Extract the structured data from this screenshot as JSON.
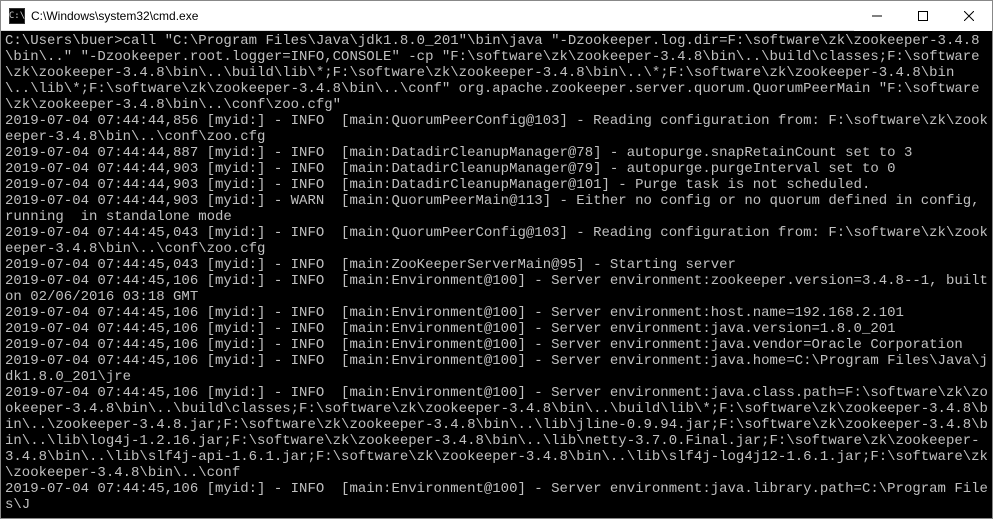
{
  "window": {
    "icon_text": "C:\\",
    "title": "C:\\Windows\\system32\\cmd.exe"
  },
  "lines": [
    "",
    "C:\\Users\\buer>call \"C:\\Program Files\\Java\\jdk1.8.0_201\"\\bin\\java \"-Dzookeeper.log.dir=F:\\software\\zk\\zookeeper-3.4.8\\bin\\..\" \"-Dzookeeper.root.logger=INFO,CONSOLE\" -cp \"F:\\software\\zk\\zookeeper-3.4.8\\bin\\..\\build\\classes;F:\\software\\zk\\zookeeper-3.4.8\\bin\\..\\build\\lib\\*;F:\\software\\zk\\zookeeper-3.4.8\\bin\\..\\*;F:\\software\\zk\\zookeeper-3.4.8\\bin\\..\\lib\\*;F:\\software\\zk\\zookeeper-3.4.8\\bin\\..\\conf\" org.apache.zookeeper.server.quorum.QuorumPeerMain \"F:\\software\\zk\\zookeeper-3.4.8\\bin\\..\\conf\\zoo.cfg\"",
    "2019-07-04 07:44:44,856 [myid:] - INFO  [main:QuorumPeerConfig@103] - Reading configuration from: F:\\software\\zk\\zookeeper-3.4.8\\bin\\..\\conf\\zoo.cfg",
    "2019-07-04 07:44:44,887 [myid:] - INFO  [main:DatadirCleanupManager@78] - autopurge.snapRetainCount set to 3",
    "2019-07-04 07:44:44,903 [myid:] - INFO  [main:DatadirCleanupManager@79] - autopurge.purgeInterval set to 0",
    "2019-07-04 07:44:44,903 [myid:] - INFO  [main:DatadirCleanupManager@101] - Purge task is not scheduled.",
    "2019-07-04 07:44:44,903 [myid:] - WARN  [main:QuorumPeerMain@113] - Either no config or no quorum defined in config, running  in standalone mode",
    "2019-07-04 07:44:45,043 [myid:] - INFO  [main:QuorumPeerConfig@103] - Reading configuration from: F:\\software\\zk\\zookeeper-3.4.8\\bin\\..\\conf\\zoo.cfg",
    "2019-07-04 07:44:45,043 [myid:] - INFO  [main:ZooKeeperServerMain@95] - Starting server",
    "2019-07-04 07:44:45,106 [myid:] - INFO  [main:Environment@100] - Server environment:zookeeper.version=3.4.8--1, built on 02/06/2016 03:18 GMT",
    "2019-07-04 07:44:45,106 [myid:] - INFO  [main:Environment@100] - Server environment:host.name=192.168.2.101",
    "2019-07-04 07:44:45,106 [myid:] - INFO  [main:Environment@100] - Server environment:java.version=1.8.0_201",
    "2019-07-04 07:44:45,106 [myid:] - INFO  [main:Environment@100] - Server environment:java.vendor=Oracle Corporation",
    "2019-07-04 07:44:45,106 [myid:] - INFO  [main:Environment@100] - Server environment:java.home=C:\\Program Files\\Java\\jdk1.8.0_201\\jre",
    "2019-07-04 07:44:45,106 [myid:] - INFO  [main:Environment@100] - Server environment:java.class.path=F:\\software\\zk\\zookeeper-3.4.8\\bin\\..\\build\\classes;F:\\software\\zk\\zookeeper-3.4.8\\bin\\..\\build\\lib\\*;F:\\software\\zk\\zookeeper-3.4.8\\bin\\..\\zookeeper-3.4.8.jar;F:\\software\\zk\\zookeeper-3.4.8\\bin\\..\\lib\\jline-0.9.94.jar;F:\\software\\zk\\zookeeper-3.4.8\\bin\\..\\lib\\log4j-1.2.16.jar;F:\\software\\zk\\zookeeper-3.4.8\\bin\\..\\lib\\netty-3.7.0.Final.jar;F:\\software\\zk\\zookeeper-3.4.8\\bin\\..\\lib\\slf4j-api-1.6.1.jar;F:\\software\\zk\\zookeeper-3.4.8\\bin\\..\\lib\\slf4j-log4j12-1.6.1.jar;F:\\software\\zk\\zookeeper-3.4.8\\bin\\..\\conf",
    "2019-07-04 07:44:45,106 [myid:] - INFO  [main:Environment@100] - Server environment:java.library.path=C:\\Program Files\\J"
  ]
}
